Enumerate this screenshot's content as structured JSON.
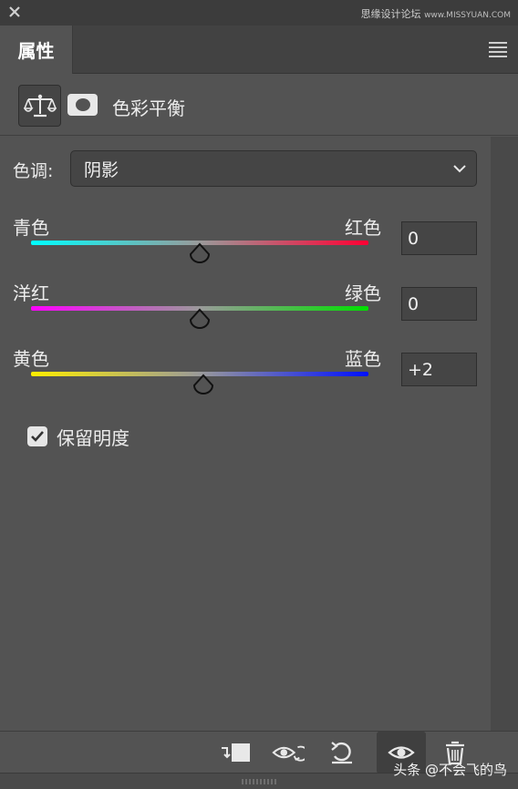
{
  "window": {
    "watermark_text": "思缘设计论坛",
    "watermark_url": "www.MISSYUAN.COM"
  },
  "tabs": {
    "properties_label": "属性"
  },
  "header": {
    "title": "色彩平衡"
  },
  "tone": {
    "label": "色调:",
    "selected": "阴影"
  },
  "sliders": [
    {
      "left_label": "青色",
      "right_label": "红色",
      "value": "0",
      "value_num": 0,
      "gradient": [
        "#00ffff",
        "#ff0033"
      ]
    },
    {
      "left_label": "洋红",
      "right_label": "绿色",
      "value": "0",
      "value_num": 0,
      "gradient": [
        "#ff00ff",
        "#00e000"
      ]
    },
    {
      "left_label": "黄色",
      "right_label": "蓝色",
      "value": "+2",
      "value_num": 2,
      "gradient": [
        "#ffee00",
        "#0010ff"
      ]
    }
  ],
  "preserve_luminosity": {
    "label": "保留明度",
    "checked": true
  },
  "footer": {
    "credit": "头条 @不会飞的鸟"
  },
  "colors": {
    "panel_bg": "#535353",
    "input_bg": "#454545",
    "text": "#e6e6e6"
  }
}
